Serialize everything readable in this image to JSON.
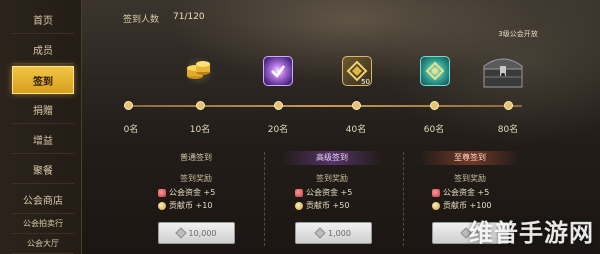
{
  "sidebar": {
    "items": [
      {
        "label": "首页"
      },
      {
        "label": "成员"
      },
      {
        "label": "签到",
        "active": true
      },
      {
        "label": "捐赠"
      },
      {
        "label": "增益"
      },
      {
        "label": "聚餐"
      },
      {
        "label": "公会商店"
      },
      {
        "label": "公会拍卖行"
      },
      {
        "label": "公会大厅"
      }
    ]
  },
  "header": {
    "count_label": "签到人数",
    "count_value": "71/120"
  },
  "milestones": [
    {
      "label": "0名",
      "icon": null
    },
    {
      "label": "10名",
      "icon": "gold-coins-icon"
    },
    {
      "label": "20名",
      "icon": "purple-orb-icon"
    },
    {
      "label": "40名",
      "icon": "gold-badge-icon",
      "badge": "50"
    },
    {
      "label": "60名",
      "icon": "teal-emblem-icon"
    },
    {
      "label": "80名",
      "icon": "chest-icon"
    }
  ],
  "chest_label": "3级公会开放",
  "progress_current": 71,
  "tiers": [
    {
      "title": "普通签到",
      "reward_title": "签到奖励",
      "rewards": [
        {
          "icon": "guild-fund-icon",
          "text": "公会资金 +5"
        },
        {
          "icon": "contribution-coin-icon",
          "text": "贡献币 +10"
        }
      ],
      "price": "10,000"
    },
    {
      "title": "高级签到",
      "reward_title": "签到奖励",
      "rewards": [
        {
          "icon": "guild-fund-icon",
          "text": "公会资金 +5"
        },
        {
          "icon": "contribution-coin-icon",
          "text": "贡献币 +50"
        }
      ],
      "price": "1,000"
    },
    {
      "title": "至尊签到",
      "reward_title": "签到奖励",
      "rewards": [
        {
          "icon": "guild-fund-icon",
          "text": "公会资金 +5"
        },
        {
          "icon": "contribution-coin-icon",
          "text": "贡献币 +100"
        }
      ],
      "price": "2"
    }
  ],
  "watermark": "维普手游网",
  "colors": {
    "accent": "#f2c544",
    "track": "#c79a52",
    "panel": "#231d16"
  }
}
